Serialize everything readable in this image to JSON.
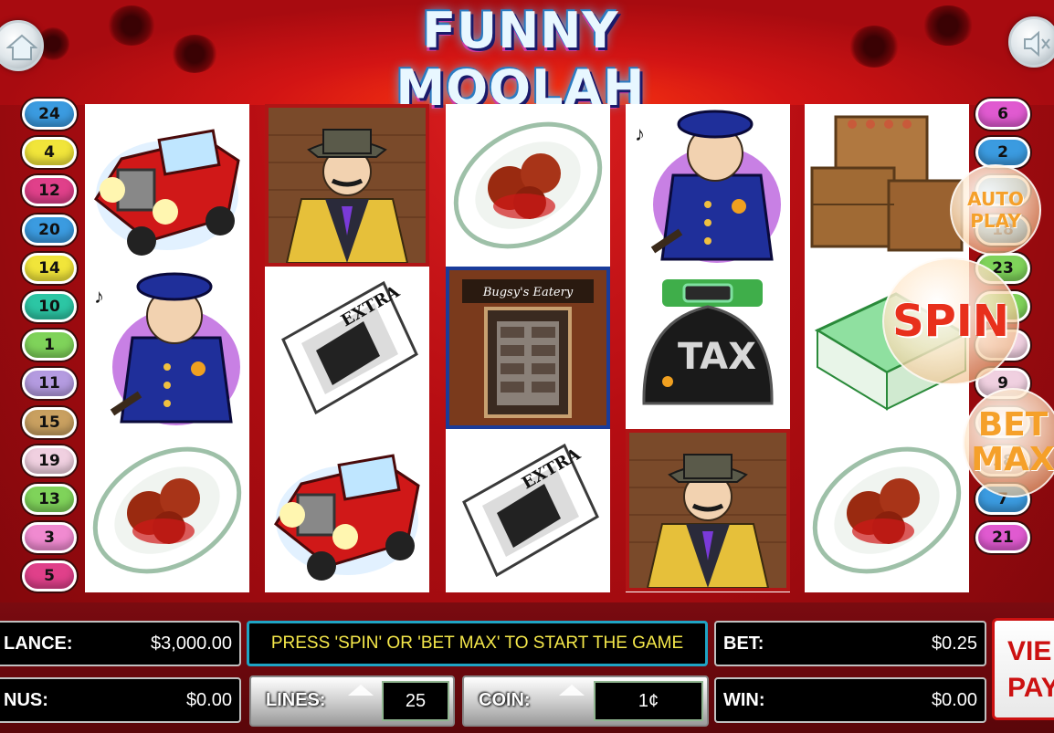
{
  "game": {
    "title": "FUNNY MOOLAH"
  },
  "paylines": {
    "left": [
      "24",
      "4",
      "12",
      "20",
      "14",
      "10",
      "1",
      "11",
      "15",
      "19",
      "13",
      "3",
      "5"
    ],
    "right": [
      "6",
      "2",
      "",
      "18",
      "23",
      "",
      "",
      "9",
      "",
      "18",
      "7",
      "21"
    ],
    "left_colors": [
      "#3b9be0",
      "#f1e53a",
      "#e0408a",
      "#3b9be0",
      "#f1e53a",
      "#2cc6a4",
      "#7fd35a",
      "#b49be0",
      "#c9a060",
      "#f0d0e0",
      "#7fd35a",
      "#f08ad0",
      "#e0408a"
    ],
    "right_colors": [
      "#e05ad0",
      "#3b9be0",
      "#3b9be0",
      "#3b9be0",
      "#7fd35a",
      "#7fd35a",
      "#f0d0e0",
      "#f0d0e0",
      "#f0d0e0",
      "#f0d0e0",
      "#3b9be0",
      "#e05ad0"
    ]
  },
  "reels": [
    [
      "car",
      "policeman",
      "meatballs"
    ],
    [
      "gangster",
      "newspaper",
      "car"
    ],
    [
      "meatballs",
      "restaurant",
      "newspaper"
    ],
    [
      "policeman",
      "tax-bag",
      "gangster"
    ],
    [
      "crates",
      "cash-stack",
      "meatballs"
    ]
  ],
  "restaurant_sign": "Bugsy's Eatery",
  "buttons": {
    "auto_play_line1": "AUTO",
    "auto_play_line2": "PLAY",
    "spin": "SPIN",
    "bet_max_line1": "BET",
    "bet_max_line2": "MAX",
    "view_pay_line1": "VIE",
    "view_pay_line2": "PAY"
  },
  "panel": {
    "balance_label": "LANCE:",
    "balance_value": "$3,000.00",
    "bonus_label": "NUS:",
    "bonus_value": "$0.00",
    "message": "PRESS 'SPIN' OR 'BET MAX' TO START THE GAME",
    "lines_label": "LINES:",
    "lines_value": "25",
    "coin_label": "COIN:",
    "coin_value": "1¢",
    "bet_label": "BET:",
    "bet_value": "$0.25",
    "win_label": "WIN:",
    "win_value": "$0.00"
  },
  "colors": {
    "accent_red": "#c41414",
    "message_text": "#f5e84a",
    "message_border": "#1fa4c4"
  }
}
